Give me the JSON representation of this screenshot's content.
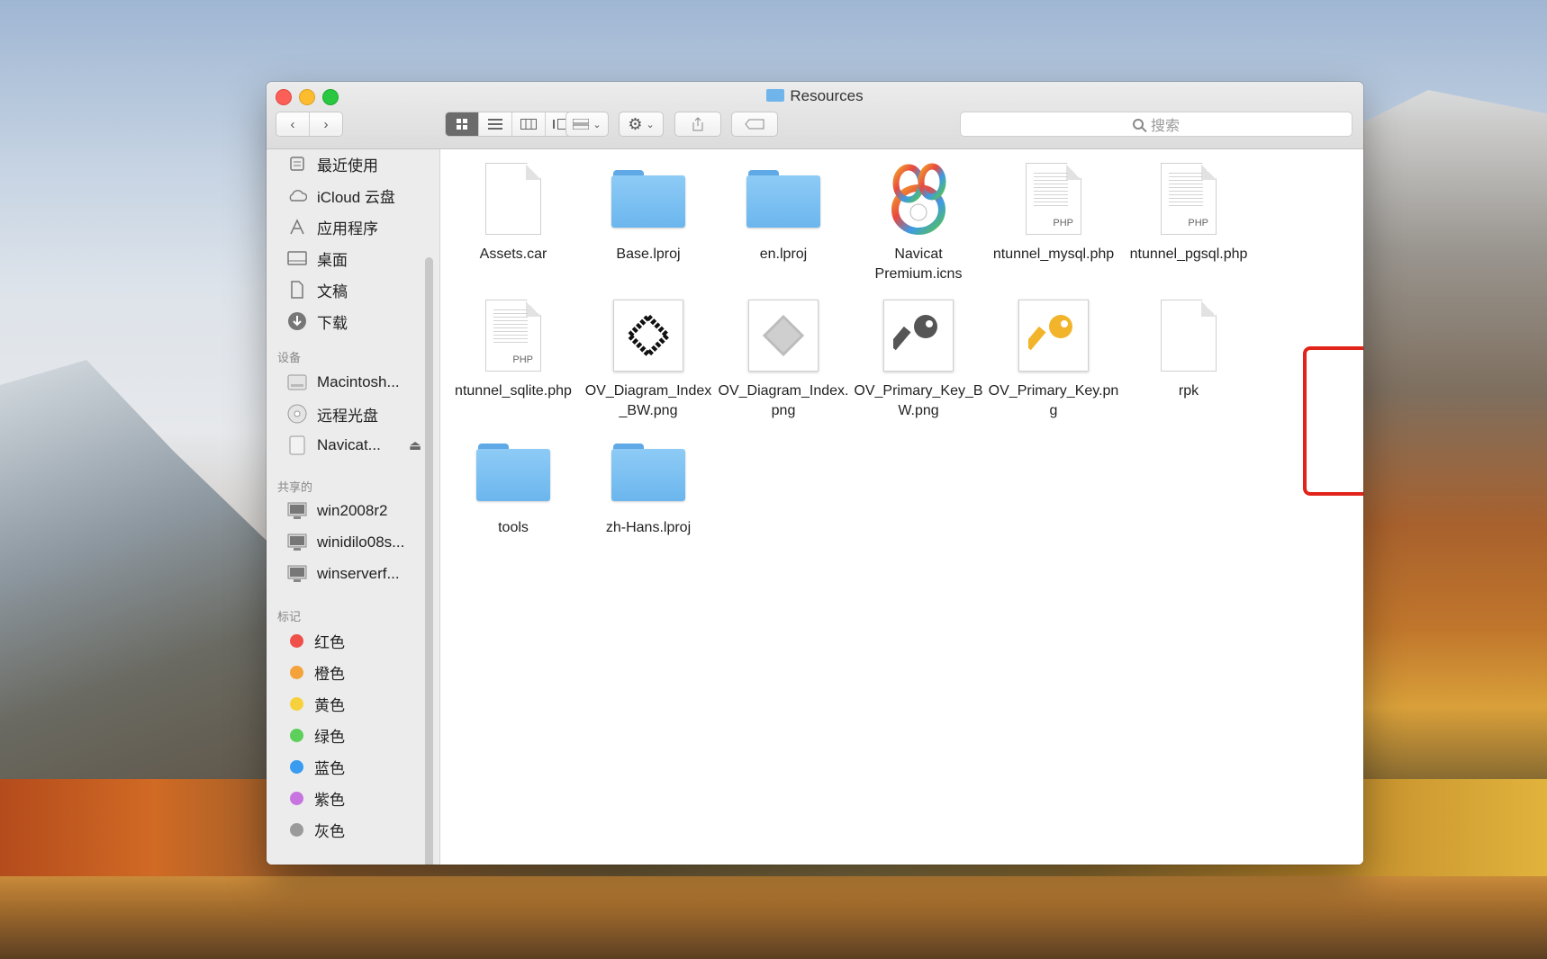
{
  "window": {
    "title": "Resources"
  },
  "toolbar": {
    "back_icon": "chevron-left-icon",
    "forward_icon": "chevron-right-icon",
    "views": [
      "icon-view",
      "list-view",
      "column-view",
      "gallery-view"
    ],
    "active_view": "icon-view",
    "search_placeholder": "搜索"
  },
  "sidebar": {
    "favorites": [
      {
        "label": "最近使用",
        "icon": "recents-icon"
      },
      {
        "label": "iCloud 云盘",
        "icon": "cloud-icon"
      },
      {
        "label": "应用程序",
        "icon": "applications-icon"
      },
      {
        "label": "桌面",
        "icon": "desktop-icon"
      },
      {
        "label": "文稿",
        "icon": "documents-icon"
      },
      {
        "label": "下载",
        "icon": "downloads-icon"
      }
    ],
    "devices_heading": "设备",
    "devices": [
      {
        "label": "Macintosh...",
        "icon": "disk-icon"
      },
      {
        "label": "远程光盘",
        "icon": "remote-disc-icon"
      },
      {
        "label": "Navicat...",
        "icon": "disk-icon",
        "eject": "⏏"
      }
    ],
    "shared_heading": "共享的",
    "shared": [
      {
        "label": "win2008r2",
        "icon": "computer-icon"
      },
      {
        "label": "winidilo08s...",
        "icon": "computer-icon"
      },
      {
        "label": "winserverf...",
        "icon": "computer-icon"
      }
    ],
    "tags_heading": "标记",
    "tags": [
      {
        "label": "红色",
        "color": "#f0504a"
      },
      {
        "label": "橙色",
        "color": "#f4a33a"
      },
      {
        "label": "黄色",
        "color": "#f7d13c"
      },
      {
        "label": "绿色",
        "color": "#5cd05a"
      },
      {
        "label": "蓝色",
        "color": "#3a9cf0"
      },
      {
        "label": "紫色",
        "color": "#c774e0"
      },
      {
        "label": "灰色",
        "color": "#9a9a9a"
      }
    ]
  },
  "files": [
    {
      "name": "Assets.car",
      "kind": "doc"
    },
    {
      "name": "Base.lproj",
      "kind": "folder"
    },
    {
      "name": "en.lproj",
      "kind": "folder"
    },
    {
      "name": "Navicat Premium.icns",
      "kind": "app-icon"
    },
    {
      "name": "ntunnel_mysql.php",
      "kind": "php",
      "tag": "PHP"
    },
    {
      "name": "ntunnel_pgsql.php",
      "kind": "php",
      "tag": "PHP"
    },
    {
      "name": "ntunnel_sqlite.php",
      "kind": "php",
      "tag": "PHP"
    },
    {
      "name": "OV_Diagram_Index_BW.png",
      "kind": "image"
    },
    {
      "name": "OV_Diagram_Index.png",
      "kind": "image"
    },
    {
      "name": "OV_Primary_Key_BW.png",
      "kind": "image"
    },
    {
      "name": "OV_Primary_Key.png",
      "kind": "image"
    },
    {
      "name": "rpk",
      "kind": "doc",
      "highlighted": true
    },
    {
      "name": "tools",
      "kind": "folder"
    },
    {
      "name": "zh-Hans.lproj",
      "kind": "folder"
    }
  ]
}
